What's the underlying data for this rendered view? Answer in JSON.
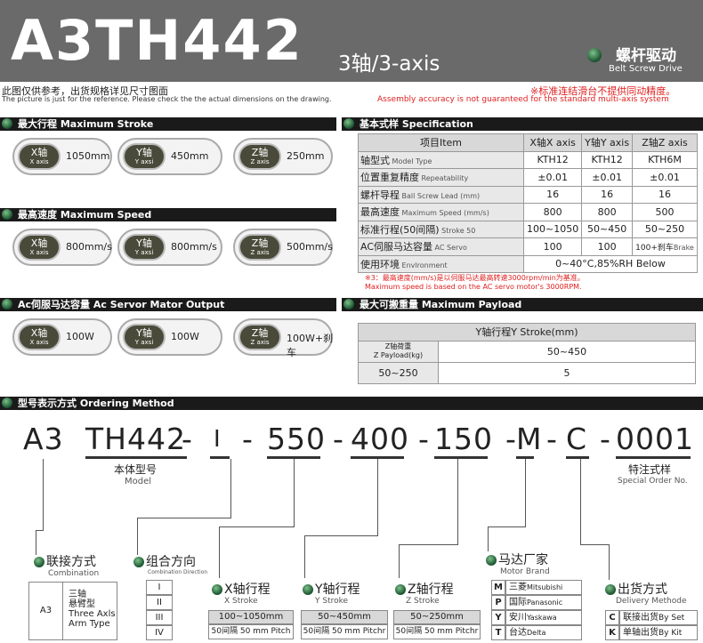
{
  "header": {
    "model": "A3TH442",
    "axis": "3轴/3-axis",
    "brand_cn": "螺杆驱动",
    "brand_en": "Belt Screw Drive"
  },
  "notes": {
    "cn": "此图仅供参考，出货规格详见尺寸图面",
    "en": "The picture is just for the reference. Please check the the actual dimensions on the drawing.",
    "warn_cn": "※标准连结滑台不提供同动精度。",
    "warn_en": "Assembly accuracy is not guaranteed for the standard multi-axis system"
  },
  "sections": {
    "stroke": "最大行程 Maximum Stroke",
    "speed": "最高速度 Maximum Speed",
    "servo": "Ac伺服马达容量 Ac Servor Mator Output",
    "spec": "基本式样 Specification",
    "payload": "最大可搬重量 Maximum Payload",
    "ordering": "型号表示方式 Ordering Method"
  },
  "axes": [
    {
      "cn": "X轴",
      "en": "X axis"
    },
    {
      "cn": "Y轴",
      "en": "Y axsi"
    },
    {
      "cn": "Z轴",
      "en": "Z axis"
    }
  ],
  "stroke_values": [
    "1050mm",
    "450mm",
    "250mm"
  ],
  "speed_values": [
    "800mm/s",
    "800mm/s",
    "500mm/s"
  ],
  "servo_values": [
    "100W",
    "100W",
    "100W+刹车"
  ],
  "spec": {
    "header": [
      "项目Item",
      "X轴X axis",
      "Y轴Y axis",
      "Z轴Z axis"
    ],
    "rows": [
      {
        "cn": "轴型式",
        "en": "Model Type",
        "v": [
          "KTH12",
          "KTH12",
          "KTH6M"
        ]
      },
      {
        "cn": "位置重复精度",
        "en": "Repeatability",
        "v": [
          "±0.01",
          "±0.01",
          "±0.01"
        ]
      },
      {
        "cn": "螺杆导程",
        "en": "Ball Screw Lead (mm)",
        "v": [
          "16",
          "16",
          "16"
        ]
      },
      {
        "cn": "最高速度",
        "en": "Maximum Speed (mm/s)",
        "v": [
          "800",
          "800",
          "500"
        ]
      },
      {
        "cn": "标准行程(50间隔)",
        "en": "Stroke 50",
        "v": [
          "100~1050",
          "50~450",
          "50~250"
        ]
      },
      {
        "cn": "AC伺服马达容量",
        "en": "AC Servo",
        "v": [
          "100",
          "100",
          "100+刹车"
        ],
        "extra": "Brake"
      },
      {
        "cn": "使用环境",
        "en": "Envlronment",
        "span": "0~40°C,85%RH Below"
      }
    ],
    "note_cn": "※3：最高速度(mm/s)是以伺服马达最高转速3000rpm/min为基准。",
    "note_en": "Maximum speed is based on the AC servo motor's 3000RPM."
  },
  "payload": {
    "head": "Y轴行程Y Stroke(mm)",
    "z_label": "Z轴荷重",
    "z_label_en": "Z Payload(kg)",
    "range": "50~450",
    "z_range": "50~250",
    "value": "5"
  },
  "ordering": {
    "code": [
      "A3",
      "TH442",
      "-",
      "I",
      "-",
      "550",
      "-",
      "400",
      "-",
      "150",
      "-",
      "M",
      "-",
      "C",
      "-",
      "0001"
    ],
    "model_cn": "本体型号",
    "model_en": "Model",
    "special_cn": "特注式样",
    "special_en": "Special Order No.",
    "combination": {
      "cn": "联接方式",
      "en": "Combination",
      "code": "A3",
      "desc_cn": "三轴",
      "desc_cn2": "悬臂型",
      "desc_en": "Three Axls",
      "desc_en2": "Arm Type"
    },
    "direction": {
      "cn": "组合方向",
      "en": "Combination Direction",
      "items": [
        "I",
        "II",
        "III",
        "IV"
      ]
    },
    "x": {
      "cn": "X轴行程",
      "en": "X Stroke",
      "range": "100~1050mm",
      "pitch": "50间隔 50 mm Pitch"
    },
    "y": {
      "cn": "Y轴行程",
      "en": "Y Stroke",
      "range": "50~450mm",
      "pitch": "50间隔 50 mm Pitchr"
    },
    "z": {
      "cn": "Z轴行程",
      "en": "Z Stroke",
      "range": "50~250mm",
      "pitch": "50间隔 50 mm Pitchr"
    },
    "motor": {
      "cn": "马达厂家",
      "en": "Motor Brand",
      "items": [
        {
          "k": "M",
          "cn": "三菱",
          "en": "Mitsubishi"
        },
        {
          "k": "P",
          "cn": "国际",
          "en": "Panasonic"
        },
        {
          "k": "Y",
          "cn": "安川",
          "en": "Yaskawa"
        },
        {
          "k": "T",
          "cn": "台达",
          "en": "Delta"
        }
      ]
    },
    "delivery": {
      "cn": "出货方式",
      "en": "Delivery Methode",
      "items": [
        {
          "k": "C",
          "cn": "联接出货",
          "en": "By Set"
        },
        {
          "k": "K",
          "cn": "单轴出货",
          "en": "By Kit"
        }
      ]
    }
  },
  "colors": {
    "header": "#6a6a6a",
    "warn": "#e02020",
    "pill": "#4a4a3a"
  }
}
